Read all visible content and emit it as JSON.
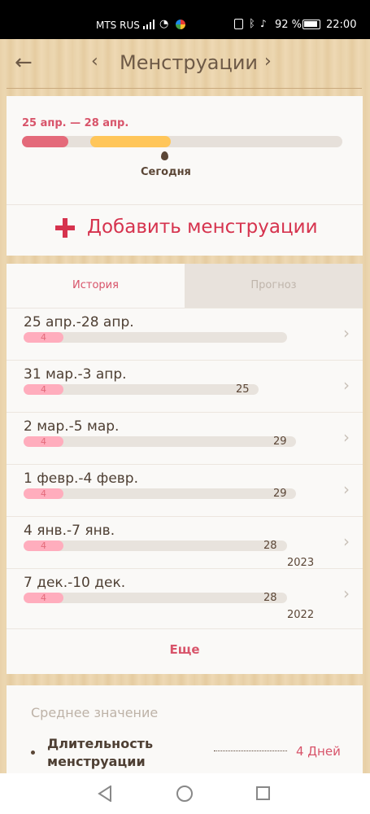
{
  "status_bar": {
    "carrier": "MTS RUS",
    "battery_percent": "92 %",
    "time": "22:00"
  },
  "header": {
    "title": "Менструации"
  },
  "current_period": {
    "range": "25 апр. — 28 апр.",
    "today_label": "Сегодня"
  },
  "add_button": {
    "label": "Добавить менструации"
  },
  "tabs": {
    "history": "История",
    "forecast": "Прогноз"
  },
  "history": [
    {
      "dates": "25 апр.-28 апр.",
      "period_days": "4",
      "cycle_days": "",
      "year": ""
    },
    {
      "dates": "31 мар.-3 апр.",
      "period_days": "4",
      "cycle_days": "25",
      "year": ""
    },
    {
      "dates": "2 мар.-5 мар.",
      "period_days": "4",
      "cycle_days": "29",
      "year": ""
    },
    {
      "dates": "1 февр.-4 февр.",
      "period_days": "4",
      "cycle_days": "29",
      "year": ""
    },
    {
      "dates": "4 янв.-7 янв.",
      "period_days": "4",
      "cycle_days": "28",
      "year": "2023"
    },
    {
      "dates": "7 дек.-10 дек.",
      "period_days": "4",
      "cycle_days": "28",
      "year": "2022"
    }
  ],
  "more_label": "Еще",
  "averages": {
    "title": "Среднее значение",
    "items": [
      {
        "label": "Длительность менструации",
        "value": "4 Дней"
      }
    ]
  },
  "colors": {
    "accent": "#d6334e",
    "period_bar": "#e46a7a",
    "fertile_bar": "#ffc65a",
    "history_pill": "#ffadbd"
  },
  "icons": [
    "back-arrow-icon",
    "chevron-left-icon",
    "chevron-right-icon",
    "plus-icon",
    "drop-icon",
    "nav-back-icon",
    "nav-home-icon",
    "nav-recent-icon"
  ]
}
